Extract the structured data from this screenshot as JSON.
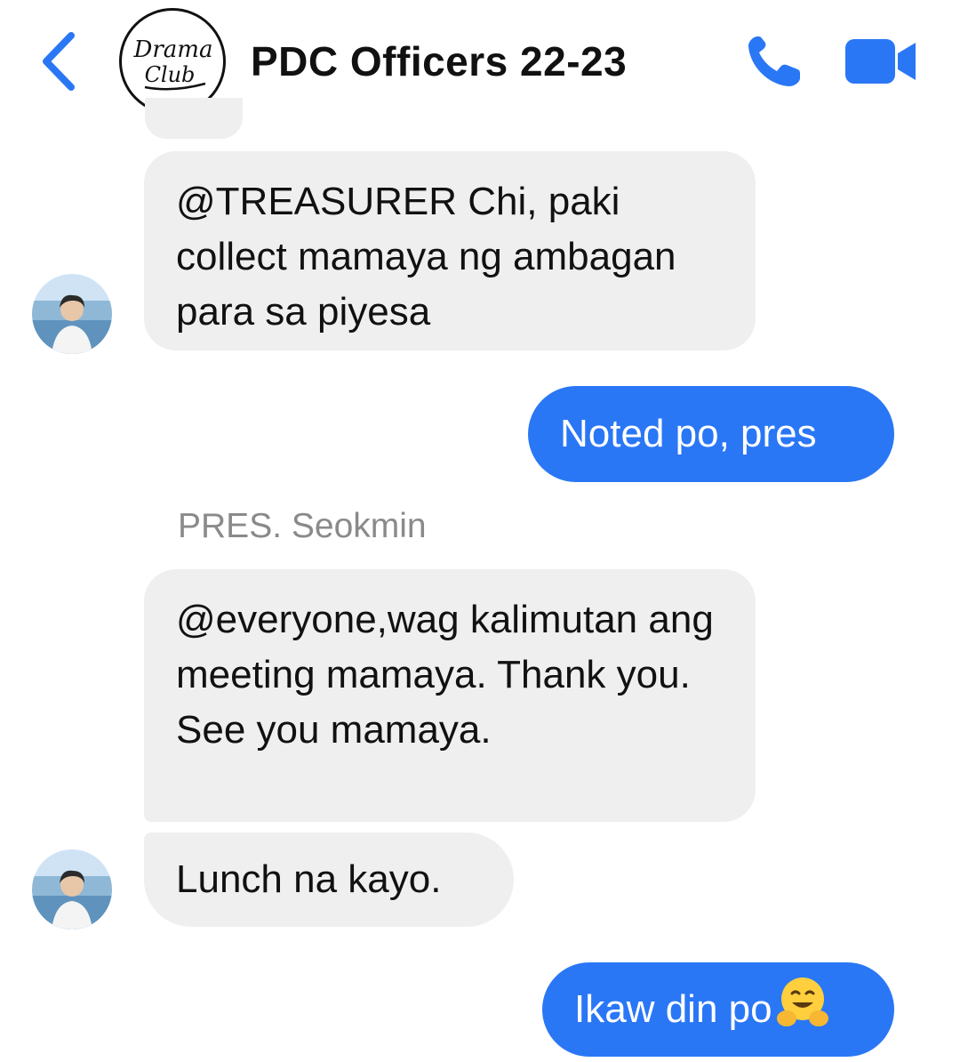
{
  "header": {
    "title": "PDC Officers 22-23",
    "avatar_logo_text": "Drama Club",
    "back_icon": "chevron-left-icon",
    "call_icon": "phone-icon",
    "video_icon": "video-camera-icon",
    "accent_color": "#2a77f6"
  },
  "messages": [
    {
      "direction": "incoming",
      "text": "@TREASURER Chi, paki collect mamaya ng ambagan para sa piyesa"
    },
    {
      "direction": "outgoing",
      "text": "Noted po, pres"
    },
    {
      "direction": "incoming",
      "sender": "PRES. Seokmin",
      "text": "@everyone,wag kalimutan ang meeting mamaya. Thank you. See you mamaya."
    },
    {
      "direction": "incoming",
      "text": "Lunch na kayo."
    },
    {
      "direction": "outgoing",
      "text": "Ikaw din po",
      "emoji": "hugging-face-emoji"
    }
  ],
  "colors": {
    "incoming_bubble": "#efefef",
    "outgoing_bubble": "#2a77f6",
    "sender_name": "#8a8a8a"
  }
}
